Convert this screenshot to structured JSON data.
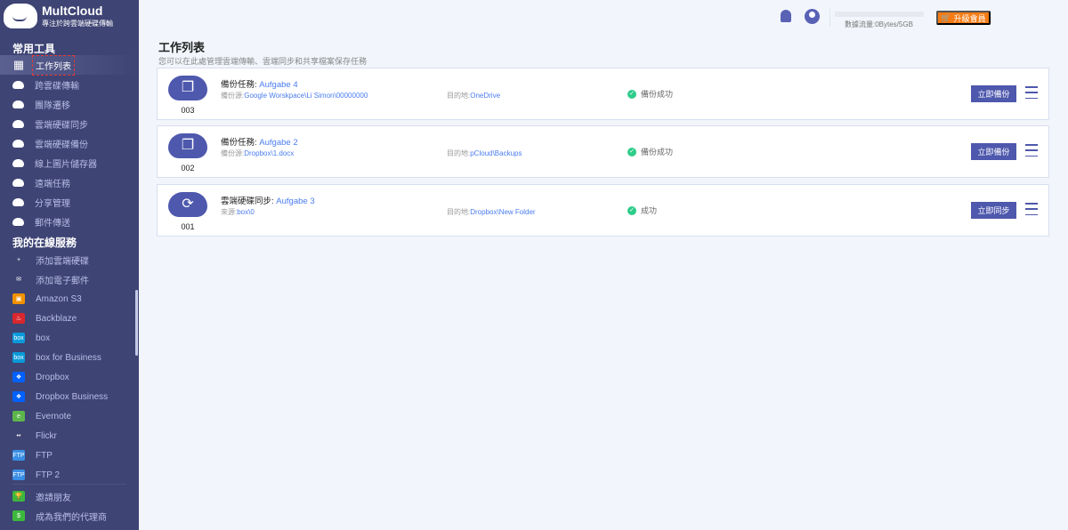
{
  "app": {
    "name": "MultCloud",
    "tagline": "專注於跨雲端硬碟傳輸"
  },
  "sidebar": {
    "section1": "常用工具",
    "tools": [
      {
        "label": "工作列表",
        "icon": "grid-icon"
      },
      {
        "label": "跨雲碟傳輸",
        "icon": "cloud-transfer-icon"
      },
      {
        "label": "團隊遷移",
        "icon": "team-migration-icon"
      },
      {
        "label": "雲端硬碟同步",
        "icon": "cloud-sync-icon"
      },
      {
        "label": "雲端硬碟備份",
        "icon": "cloud-backup-icon"
      },
      {
        "label": "線上圖片儲存器",
        "icon": "image-saver-icon"
      },
      {
        "label": "遠端任務",
        "icon": "remote-upload-icon"
      },
      {
        "label": "分享管理",
        "icon": "share-icon"
      },
      {
        "label": "郵件傳送",
        "icon": "email-migration-icon"
      }
    ],
    "section2": "我的在線服務",
    "services": [
      {
        "label": "添加雲端硬碟",
        "icon": "add-cloud-icon",
        "color": "#ffffff"
      },
      {
        "label": "添加電子郵件",
        "icon": "add-email-icon",
        "color": "#ffffff"
      },
      {
        "label": "Amazon S3",
        "icon": "amazon-s3-icon",
        "color": "#f29100"
      },
      {
        "label": "Backblaze",
        "icon": "backblaze-icon",
        "color": "#d9272e"
      },
      {
        "label": "box",
        "icon": "box-icon",
        "color": "#0a9ad9"
      },
      {
        "label": "box for Business",
        "icon": "box-business-icon",
        "color": "#0a9ad9"
      },
      {
        "label": "Dropbox",
        "icon": "dropbox-icon",
        "color": "#0061fe"
      },
      {
        "label": "Dropbox Business",
        "icon": "dropbox-business-icon",
        "color": "#0061fe"
      },
      {
        "label": "Evernote",
        "icon": "evernote-icon",
        "color": "#5db64c"
      },
      {
        "label": "Flickr",
        "icon": "flickr-icon",
        "color": "#ffffff"
      },
      {
        "label": "FTP",
        "icon": "ftp-icon",
        "color": "#3a8ee6"
      },
      {
        "label": "FTP 2",
        "icon": "ftp-icon",
        "color": "#3a8ee6"
      }
    ],
    "footer": [
      {
        "label": "邀請朋友",
        "icon": "trophy-icon",
        "color": "#3db83d"
      },
      {
        "label": "成為我們的代理商",
        "icon": "dollar-icon",
        "color": "#3db83d"
      }
    ]
  },
  "header": {
    "quota": "數據流量:0Bytes/5GB",
    "quota_fraction": 0,
    "upgrade": "升級會員"
  },
  "main": {
    "title": "工作列表",
    "subtitle": "您可以在此處管理雲端傳輸、雲端同步和共享檔案保存任務",
    "tasks": [
      {
        "num": "003",
        "type": "備份任務: ",
        "name": "Aufgabe 4",
        "src_label": "備份源:",
        "src": "Google Worskpace\\Li Simon\\00000000",
        "dst_label": "目的地:",
        "dst": "OneDrive",
        "status": "備份成功",
        "action": "立即備份",
        "icon": "backup"
      },
      {
        "num": "002",
        "type": "備份任務: ",
        "name": "Aufgabe 2",
        "src_label": "備份源:",
        "src": "Dropbox\\1.docx",
        "dst_label": "目的地:",
        "dst": "pCloud\\Backups",
        "status": "備份成功",
        "action": "立即備份",
        "icon": "backup"
      },
      {
        "num": "001",
        "type": "雲端硬碟同步: ",
        "name": "Aufgabe 3",
        "src_label": "來源:",
        "src": "box\\0",
        "dst_label": "目的地:",
        "dst": "Dropbox\\New Folder",
        "status": "成功",
        "action": "立即同步",
        "icon": "sync"
      }
    ]
  }
}
